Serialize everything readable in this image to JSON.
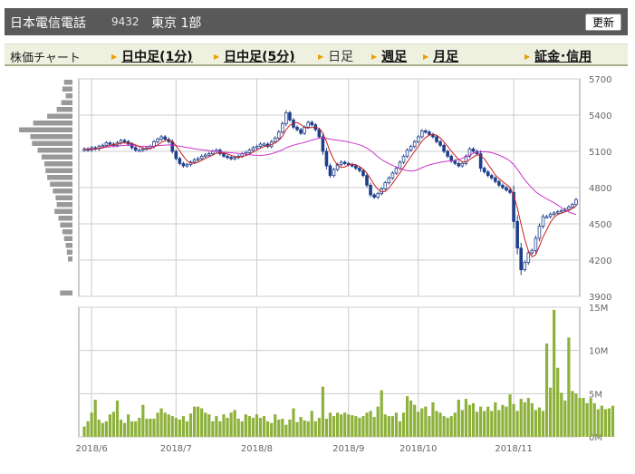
{
  "header": {
    "company": "日本電信電話",
    "code": "9432",
    "market": "東京 1部",
    "refresh_label": "更新"
  },
  "tabs": {
    "label": "株価チャート",
    "items": [
      {
        "label": "日中足(1分)",
        "active": false
      },
      {
        "label": "日中足(5分)",
        "active": false
      },
      {
        "label": "日足",
        "active": true
      },
      {
        "label": "週足",
        "active": false
      },
      {
        "label": "月足",
        "active": false
      },
      {
        "label": "証金･信用",
        "active": false
      }
    ]
  },
  "colors": {
    "up": "#1f3f8a",
    "down": "#1f3f8a",
    "ma_short": "#cc1f1f",
    "ma_long": "#cc33cc",
    "volume": "#8db13b",
    "profile": "#999999",
    "grid": "#cccccc"
  },
  "chart_data": [
    {
      "type": "candlestick",
      "title": "",
      "ylim": [
        3900,
        5700
      ],
      "y_ticks": [
        "5700",
        "5400",
        "5100",
        "4800",
        "4500",
        "4200",
        "3900"
      ],
      "y_tick_values": [
        5700,
        5400,
        5100,
        4800,
        4500,
        4200,
        3900
      ],
      "x_ticks": [
        "2018/6",
        "2018/7",
        "2018/8",
        "2018/9",
        "2018/10",
        "2018/11"
      ],
      "x_tick_index": [
        2,
        25,
        47,
        72,
        91,
        117
      ],
      "grid": true,
      "n": 135,
      "close": [
        5120,
        5110,
        5130,
        5120,
        5140,
        5150,
        5170,
        5160,
        5150,
        5170,
        5190,
        5180,
        5160,
        5130,
        5110,
        5110,
        5120,
        5130,
        5140,
        5180,
        5200,
        5220,
        5200,
        5180,
        5100,
        5040,
        5000,
        4980,
        4990,
        5010,
        5030,
        5040,
        5060,
        5070,
        5080,
        5100,
        5110,
        5080,
        5060,
        5050,
        5040,
        5050,
        5060,
        5080,
        5090,
        5110,
        5130,
        5140,
        5160,
        5160,
        5140,
        5180,
        5210,
        5260,
        5330,
        5420,
        5360,
        5300,
        5280,
        5250,
        5300,
        5340,
        5320,
        5280,
        5220,
        5100,
        4980,
        4900,
        4950,
        4990,
        5010,
        5000,
        4990,
        4980,
        4960,
        4940,
        4900,
        4820,
        4740,
        4720,
        4750,
        4790,
        4840,
        4880,
        4920,
        4960,
        5010,
        5060,
        5110,
        5140,
        5180,
        5220,
        5270,
        5260,
        5240,
        5220,
        5180,
        5150,
        5100,
        5060,
        5020,
        5000,
        4980,
        5000,
        5060,
        5120,
        5100,
        5080,
        4960,
        4930,
        4900,
        4880,
        4850,
        4820,
        4800,
        4780,
        4760,
        4520,
        4300,
        4120,
        4180,
        4260,
        4280,
        4380,
        4480,
        4560,
        4560,
        4580,
        4590,
        4600,
        4610,
        4620,
        4640,
        4660,
        4700
      ],
      "volume_ylim": [
        0,
        15000000
      ],
      "volume_ticks": [
        "15M",
        "10M",
        "5M",
        "0M"
      ],
      "volume_tick_values": [
        15000000,
        10000000,
        5000000,
        0
      ],
      "volume": [
        1200000,
        1800000,
        2800000,
        4300000,
        2000000,
        1600000,
        1800000,
        2600000,
        2900000,
        4200000,
        2000000,
        1600000,
        2600000,
        1800000,
        1800000,
        2200000,
        3700000,
        2100000,
        2100000,
        2100000,
        2800000,
        3300000,
        2800000,
        2600000,
        2400000,
        2200000,
        2000000,
        2400000,
        1800000,
        2700000,
        3500000,
        3500000,
        3300000,
        2800000,
        2600000,
        1800000,
        2400000,
        1800000,
        2600000,
        2200000,
        2800000,
        3100000,
        2100000,
        1800000,
        2600000,
        2400000,
        2200000,
        2600000,
        2200000,
        2400000,
        1800000,
        1600000,
        2600000,
        2000000,
        2100000,
        1400000,
        2000000,
        3300000,
        1700000,
        2300000,
        1900000,
        1800000,
        3000000,
        1800000,
        2200000,
        5800000,
        2100000,
        2800000,
        2400000,
        2800000,
        2600000,
        2800000,
        2600000,
        2500000,
        2400000,
        2200000,
        2400000,
        2800000,
        3000000,
        2300000,
        3500000,
        5400000,
        2600000,
        2400000,
        2400000,
        2800000,
        1800000,
        2800000,
        4700000,
        4200000,
        3700000,
        2900000,
        3300000,
        3500000,
        2400000,
        4000000,
        3000000,
        2800000,
        2400000,
        2200000,
        2400000,
        2800000,
        4300000,
        3100000,
        4400000,
        3700000,
        3900000,
        2900000,
        3500000,
        3000000,
        3500000,
        3000000,
        4000000,
        3100000,
        3700000,
        3500000,
        4900000,
        3800000,
        3000000,
        4400000,
        4000000,
        4500000,
        3900000,
        3100000,
        3400000,
        3000000,
        10800000,
        5700000,
        14700000,
        8000000,
        5100000,
        4200000,
        11500000,
        5300000,
        5000000,
        4500000,
        4500000,
        3900000,
        4500000,
        3900000,
        3200000,
        3600000,
        3200000,
        3300000,
        3600000
      ],
      "volume_profile": [
        0.15,
        0.18,
        0.12,
        0.2,
        0.28,
        0.45,
        0.7,
        0.95,
        0.75,
        0.72,
        0.62,
        0.55,
        0.5,
        0.48,
        0.45,
        0.4,
        0.35,
        0.3,
        0.28,
        0.32,
        0.25,
        0.22,
        0.18,
        0.15,
        0.12,
        0.1,
        0.08,
        0,
        0,
        0,
        0,
        0.22
      ]
    }
  ]
}
